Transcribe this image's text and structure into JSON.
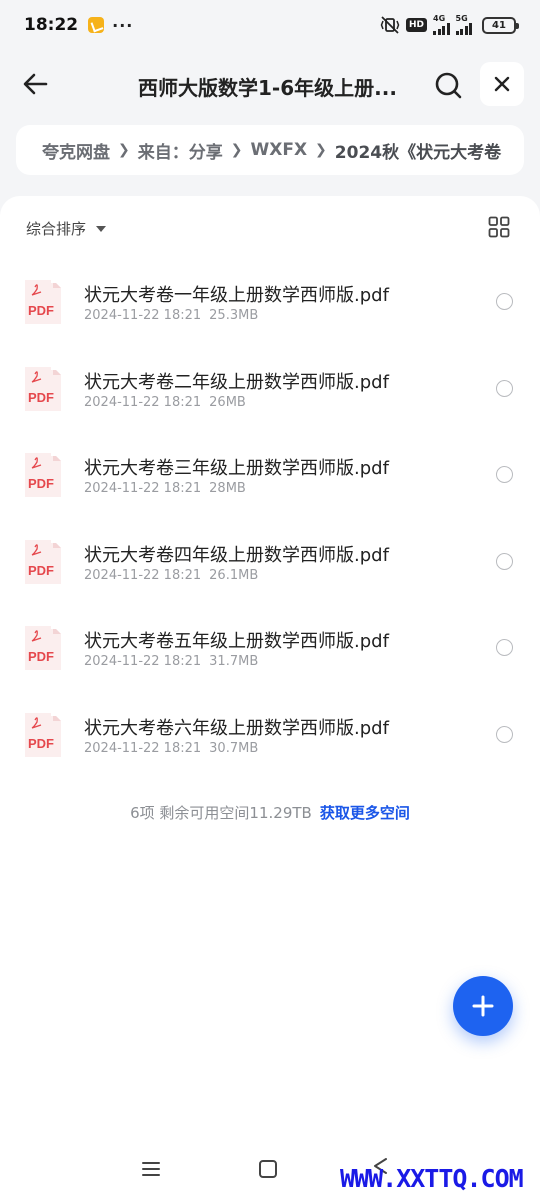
{
  "status_bar": {
    "time": "18:22",
    "more": "···",
    "hd": "HD",
    "sim1_label": "4G",
    "sim2_label": "5G",
    "battery": "41"
  },
  "header": {
    "title": "西师大版数学1-6年级上册..."
  },
  "breadcrumb": {
    "items": [
      "夸克网盘",
      "来自：分享",
      "WXFX",
      "2024秋《状元大考卷"
    ]
  },
  "toolbar": {
    "sort_label": "综合排序"
  },
  "files": [
    {
      "name": "状元大考卷一年级上册数学西师版.pdf",
      "date": "2024-11-22 18:21",
      "size": "25.3MB",
      "icon_text": "PDF"
    },
    {
      "name": "状元大考卷二年级上册数学西师版.pdf",
      "date": "2024-11-22 18:21",
      "size": "26MB",
      "icon_text": "PDF"
    },
    {
      "name": "状元大考卷三年级上册数学西师版.pdf",
      "date": "2024-11-22 18:21",
      "size": "28MB",
      "icon_text": "PDF"
    },
    {
      "name": "状元大考卷四年级上册数学西师版.pdf",
      "date": "2024-11-22 18:21",
      "size": "26.1MB",
      "icon_text": "PDF"
    },
    {
      "name": "状元大考卷五年级上册数学西师版.pdf",
      "date": "2024-11-22 18:21",
      "size": "31.7MB",
      "icon_text": "PDF"
    },
    {
      "name": "状元大考卷六年级上册数学西师版.pdf",
      "date": "2024-11-22 18:21",
      "size": "30.7MB",
      "icon_text": "PDF"
    }
  ],
  "footer": {
    "summary": "6项 剩余可用空间11.29TB",
    "link": "获取更多空间"
  },
  "watermark": "WWW.XXTTQ.COM",
  "colors": {
    "accent": "#1e63f0",
    "link": "#1a56e8",
    "pdf_red": "#e5484d",
    "background": "#f4f5f7"
  },
  "icons": {
    "back": "arrow-left-icon",
    "search": "search-icon",
    "close": "close-icon",
    "sort": "chevron-down-icon",
    "view": "grid-view-icon",
    "file": "pdf-file-icon",
    "fab": "plus-icon"
  }
}
